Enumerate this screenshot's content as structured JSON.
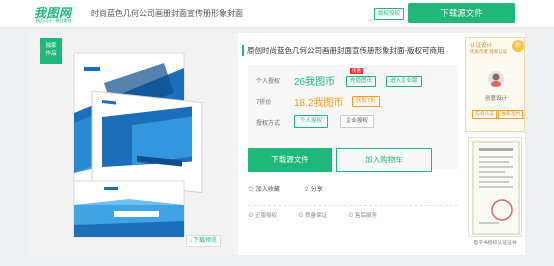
{
  "header": {
    "logo": "我图网",
    "logo_sub": "精品设计 · 原创素材",
    "page_title": "时尚蓝色几何公司画册封面宣传册形象封面",
    "tag": "版权授权",
    "download_label": "下载源文件"
  },
  "preview": {
    "badge_line1": "独家",
    "badge_line2": "作品",
    "preview_link": "↓下载预览"
  },
  "product": {
    "title": "原创时尚蓝色几何公司画册封面宣传册形象封面-版权可商用",
    "personal_label": "个人授权",
    "personal_price": "26我图币",
    "hot_badge": "优惠",
    "tag_vip": "充值图币",
    "tag_enterprise": "进入企业版",
    "discount_label": "7折价",
    "discount_price": "18.2我图币",
    "tag_buy": "获取7折",
    "license_label": "授权方式",
    "license_options": [
      "个人授权",
      "企业授权"
    ],
    "download_label": "下载源文件",
    "cart_label": "加入购物车",
    "fav_label": "加入收藏",
    "share_label": "分享",
    "features": [
      "正版授权",
      "质量保证",
      "售后服务"
    ]
  },
  "sidebar": {
    "auth_title": "认证设计",
    "auth_sub": "优质作者 独家认证",
    "designer_name": "创意设计",
    "tags": [
      "实名认证",
      "独家签约"
    ],
    "cert_caption": "电子书授权认证证书"
  },
  "colors": {
    "brand": "#1fb77a",
    "accent": "#f0a020"
  }
}
